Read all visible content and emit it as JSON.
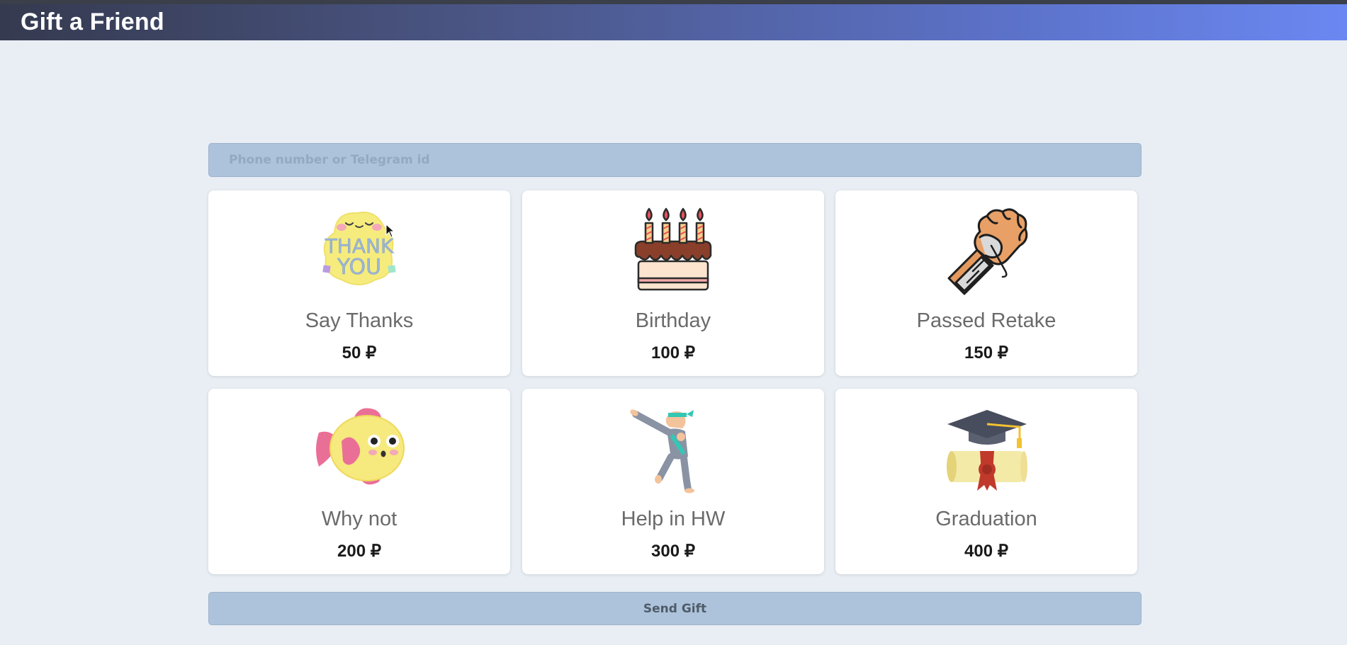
{
  "header": {
    "title": "Gift a Friend"
  },
  "search": {
    "placeholder": "Phone number or Telegram id",
    "value": ""
  },
  "gifts": [
    {
      "name": "Say Thanks",
      "price": "50 ₽",
      "icon": "thank-you-sticker-icon",
      "icon_text": [
        "THANK",
        "YOU"
      ]
    },
    {
      "name": "Birthday",
      "price": "100 ₽",
      "icon": "birthday-cake-icon"
    },
    {
      "name": "Passed Retake",
      "price": "150 ₽",
      "icon": "bandaged-fist-icon"
    },
    {
      "name": "Why not",
      "price": "200 ₽",
      "icon": "pufferfish-icon"
    },
    {
      "name": "Help in HW",
      "price": "300 ₽",
      "icon": "karate-kick-icon"
    },
    {
      "name": "Graduation",
      "price": "400 ₽",
      "icon": "graduation-cap-diploma-icon"
    }
  ],
  "actions": {
    "send_label": "Send Gift"
  },
  "colors": {
    "accent": "#adc3dc",
    "header_start": "#353a4f",
    "header_end": "#6b88f2",
    "background": "#e8eef4"
  }
}
